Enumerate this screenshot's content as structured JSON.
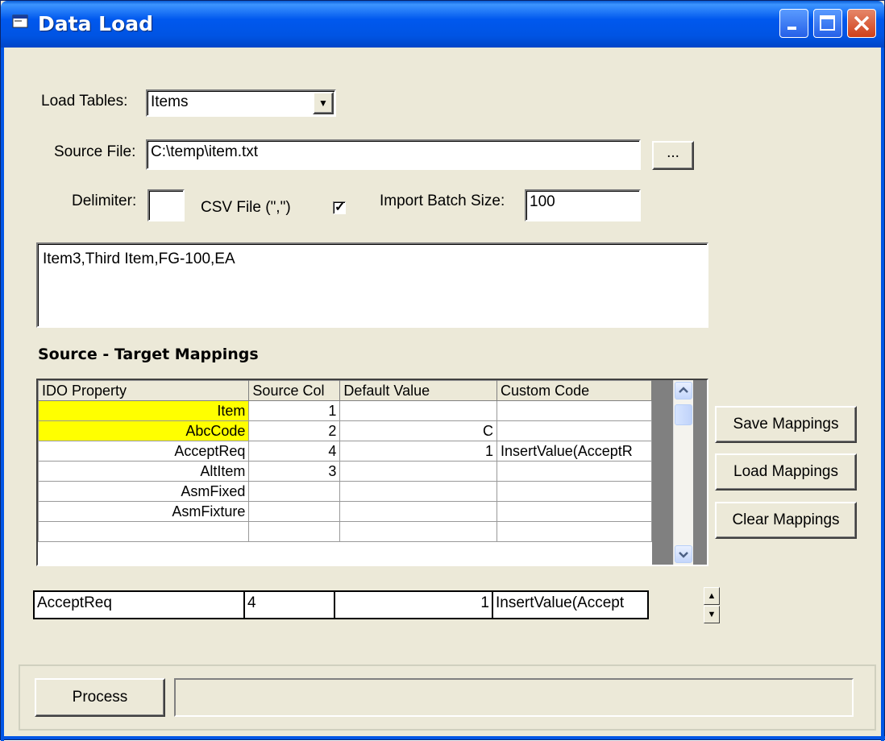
{
  "window": {
    "title": "Data Load",
    "icon": "app-window-icon"
  },
  "form": {
    "load_tables_label": "Load Tables:",
    "load_tables_value": "Items",
    "source_file_label": "Source File:",
    "source_file_value": "C:\\temp\\item.txt",
    "browse_label": "...",
    "delimiter_label": "Delimiter:",
    "delimiter_value": "",
    "csv_label": "CSV File (\",\")",
    "csv_checked": true,
    "batch_size_label": "Import Batch Size:",
    "batch_size_value": "100",
    "preview_text": "Item3,Third Item,FG-100,EA"
  },
  "mappings": {
    "section_title": "Source - Target Mappings",
    "columns": [
      "IDO Property",
      "Source Col",
      "Default Value",
      "Custom Code"
    ],
    "rows": [
      {
        "property": "Item",
        "source_col": "1",
        "default": "",
        "code": "",
        "required": true
      },
      {
        "property": "AbcCode",
        "source_col": "2",
        "default": "C",
        "code": "",
        "required": true
      },
      {
        "property": "AcceptReq",
        "source_col": "4",
        "default": "1",
        "code": "InsertValue(AcceptR",
        "required": false
      },
      {
        "property": "AltItem",
        "source_col": "3",
        "default": "",
        "code": "",
        "required": false
      },
      {
        "property": "AsmFixed",
        "source_col": "",
        "default": "",
        "code": "",
        "required": false
      },
      {
        "property": "AsmFixture",
        "source_col": "",
        "default": "",
        "code": "",
        "required": false
      }
    ],
    "buttons": {
      "save": "Save Mappings",
      "load": "Load Mappings",
      "clear": "Clear Mappings"
    }
  },
  "edit_row": {
    "property": "AcceptReq",
    "source_col": "4",
    "default": "1",
    "code": "InsertValue(Accept"
  },
  "footer": {
    "process_label": "Process",
    "status_text": ""
  },
  "colors": {
    "required_row": "#FFFF00",
    "window_bg": "#ECE9D8",
    "titlebar": "#0054E3"
  }
}
